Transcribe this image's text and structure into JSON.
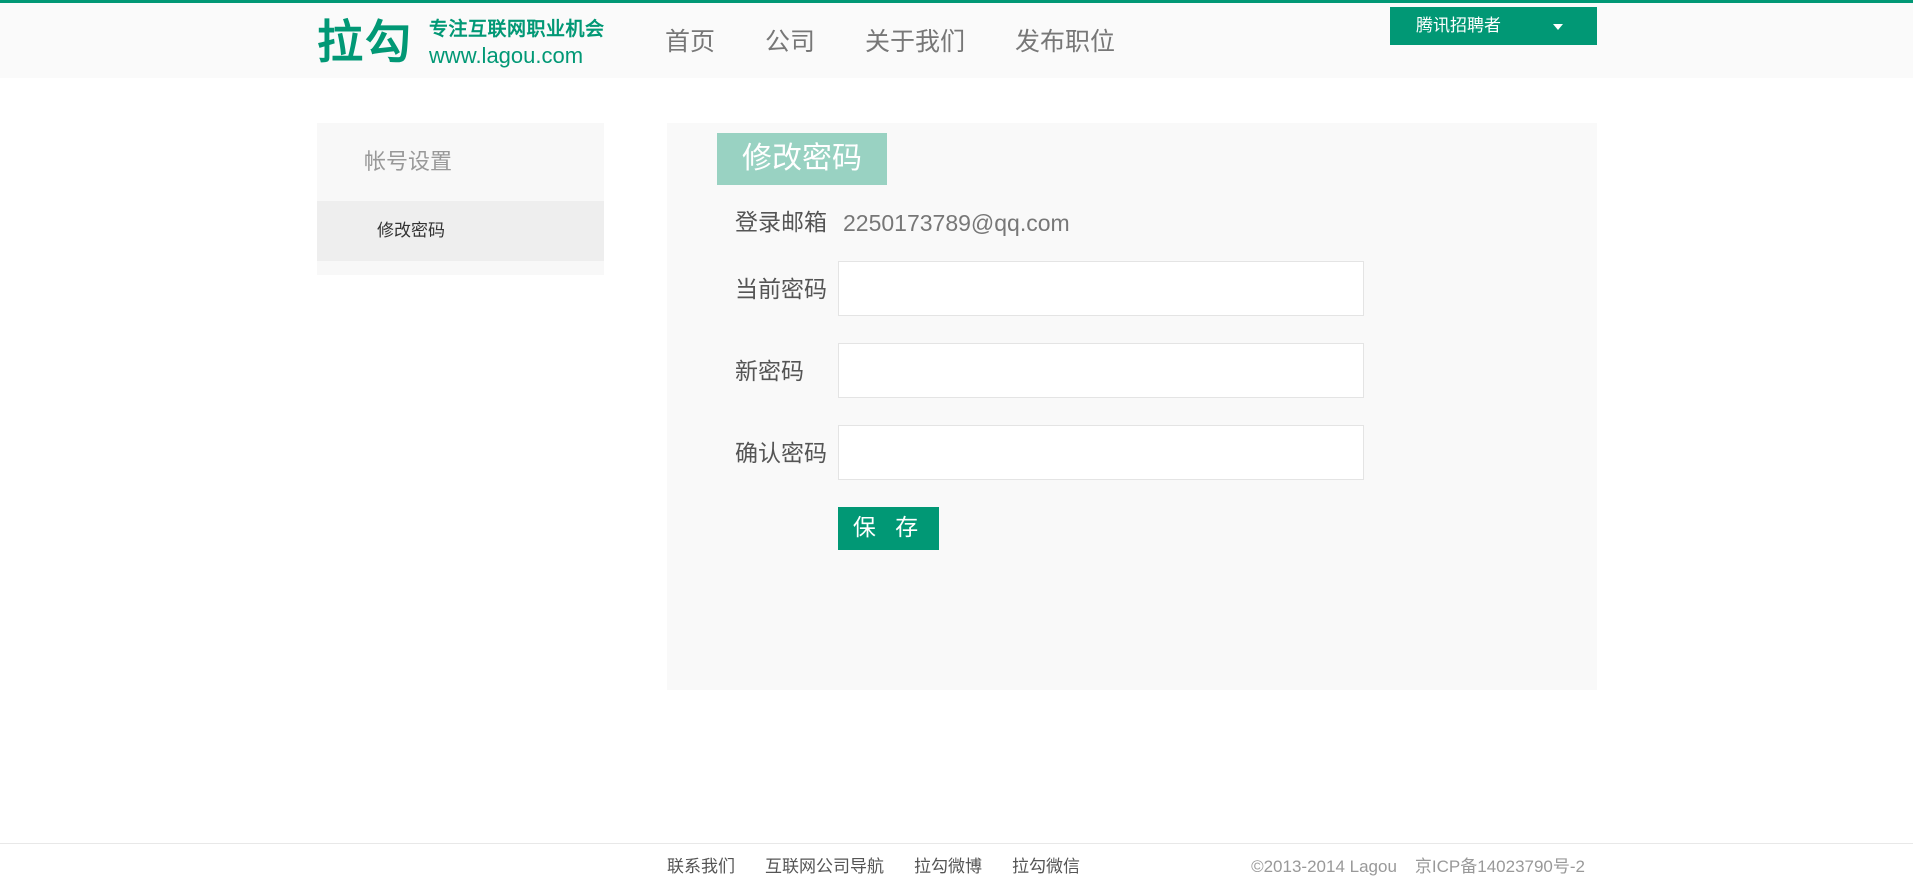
{
  "brand": {
    "logo_text": "拉勾",
    "tagline": "专注互联网职业机会",
    "url": "www.lagou.com",
    "accent": "#019875",
    "title_bg": "#99d2c2"
  },
  "header": {
    "nav": [
      "首页",
      "公司",
      "关于我们",
      "发布职位"
    ],
    "user_menu": {
      "label": "腾讯招聘者",
      "icon": "dropdown-caret-icon"
    }
  },
  "sidebar": {
    "title": "帐号设置",
    "items": [
      {
        "label": "修改密码",
        "selected": true
      }
    ]
  },
  "main": {
    "title": "修改密码",
    "email_label": "登录邮箱",
    "email_value": "2250173789@qq.com",
    "current_password_label": "当前密码",
    "current_password_value": "",
    "new_password_label": "新密码",
    "new_password_value": "",
    "confirm_password_label": "确认密码",
    "confirm_password_value": "",
    "save_label": "保 存"
  },
  "footer": {
    "links": [
      "联系我们",
      "互联网公司导航",
      "拉勾微博",
      "拉勾微信"
    ],
    "copyright": "©2013-2014 Lagou",
    "icp": "京ICP备14023790号-2"
  }
}
